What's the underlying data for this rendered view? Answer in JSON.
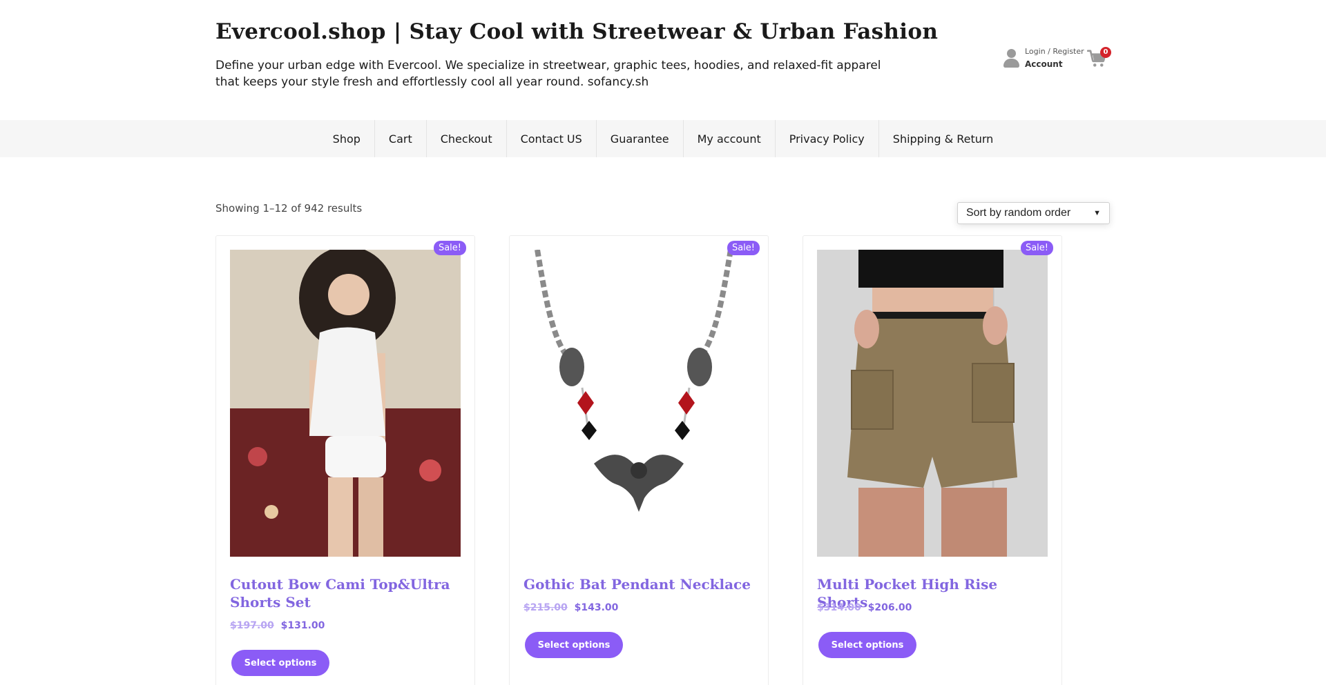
{
  "header": {
    "site_title": "Evercool.shop | Stay Cool with Streetwear & Urban Fashion",
    "site_description": "Define your urban edge with Evercool. We specialize in streetwear, graphic tees, hoodies, and relaxed-fit apparel that keeps your style fresh and effortlessly cool all year round. sofancy.sh",
    "account": {
      "small_label": "Login / Register",
      "main_label": "Account",
      "icon": "user-icon"
    },
    "cart": {
      "icon": "cart-icon",
      "count": "0",
      "badge_color": "#d4232b"
    }
  },
  "nav": {
    "items": [
      {
        "label": "Shop"
      },
      {
        "label": "Cart"
      },
      {
        "label": "Checkout"
      },
      {
        "label": "Contact US"
      },
      {
        "label": "Guarantee"
      },
      {
        "label": "My account"
      },
      {
        "label": "Privacy Policy"
      },
      {
        "label": "Shipping & Return"
      }
    ]
  },
  "shop": {
    "result_count": "Showing 1–12 of 942 results",
    "sort": {
      "selected": "Sort by random order"
    },
    "accent_color": "#8b5cf6",
    "products": [
      {
        "badge": "Sale!",
        "title": "Cutout Bow Cami Top&Ultra Shorts Set",
        "old_price": "$197.00",
        "new_price": "$131.00",
        "button": "Select options"
      },
      {
        "badge": "Sale!",
        "title": "Gothic Bat Pendant Necklace",
        "old_price": "$215.00",
        "new_price": "$143.00",
        "button": "Select options"
      },
      {
        "badge": "Sale!",
        "title": "Multi Pocket High Rise Shorts",
        "old_price": "$314.00",
        "new_price": "$206.00",
        "button": "Select options"
      }
    ]
  }
}
